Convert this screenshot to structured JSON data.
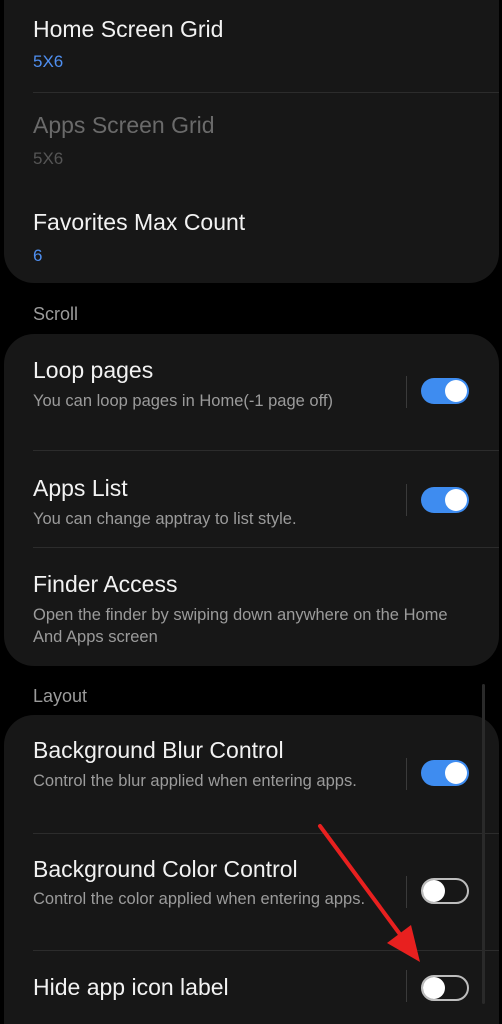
{
  "grid_card": {
    "home_grid": {
      "title": "Home Screen Grid",
      "value": "5X6"
    },
    "apps_grid": {
      "title": "Apps Screen Grid",
      "value": "5X6"
    },
    "favorites": {
      "title": "Favorites Max Count",
      "value": "6"
    }
  },
  "scroll_section": {
    "header": "Scroll",
    "loop_pages": {
      "title": "Loop pages",
      "subtitle": "You can loop pages in Home(-1 page off)",
      "enabled": true
    },
    "apps_list": {
      "title": "Apps List",
      "subtitle": "You can change apptray to list style.",
      "enabled": true
    },
    "finder_access": {
      "title": "Finder Access",
      "subtitle": "Open the finder by swiping down anywhere on the Home And Apps screen"
    }
  },
  "layout_section": {
    "header": "Layout",
    "blur_control": {
      "title": "Background Blur Control",
      "subtitle": "Control the blur applied when entering apps.",
      "enabled": true
    },
    "color_control": {
      "title": "Background Color Control",
      "subtitle": "Control the color applied when entering apps.",
      "enabled": false
    },
    "hide_label": {
      "title": "Hide app icon label",
      "enabled": false
    }
  },
  "colors": {
    "accent": "#3e8cf0",
    "value_blue": "#4f8ff0",
    "card_bg": "#171717",
    "background": "#000000",
    "annotation_arrow": "#e8201f"
  }
}
